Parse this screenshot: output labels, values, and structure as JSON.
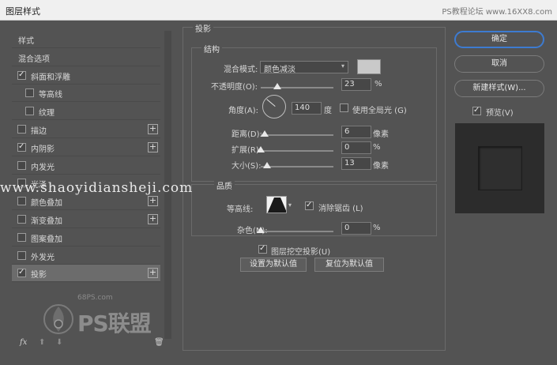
{
  "window": {
    "title": "图层样式",
    "watermark": "PS教程论坛 www.16XX8.com"
  },
  "styles_list": {
    "items": [
      {
        "label": "样式",
        "checkbox": false,
        "checked": false,
        "plus": false,
        "indent": false,
        "selected": false
      },
      {
        "label": "混合选项",
        "checkbox": false,
        "checked": false,
        "plus": false,
        "indent": false,
        "selected": false
      },
      {
        "label": "斜面和浮雕",
        "checkbox": true,
        "checked": true,
        "plus": false,
        "indent": false,
        "selected": false
      },
      {
        "label": "等高线",
        "checkbox": true,
        "checked": false,
        "plus": false,
        "indent": true,
        "selected": false
      },
      {
        "label": "纹理",
        "checkbox": true,
        "checked": false,
        "plus": false,
        "indent": true,
        "selected": false
      },
      {
        "label": "描边",
        "checkbox": true,
        "checked": false,
        "plus": true,
        "indent": false,
        "selected": false
      },
      {
        "label": "内阴影",
        "checkbox": true,
        "checked": true,
        "plus": true,
        "indent": false,
        "selected": false
      },
      {
        "label": "内发光",
        "checkbox": true,
        "checked": false,
        "plus": false,
        "indent": false,
        "selected": false
      },
      {
        "label": "光泽",
        "checkbox": true,
        "checked": false,
        "plus": false,
        "indent": false,
        "selected": false
      },
      {
        "label": "颜色叠加",
        "checkbox": true,
        "checked": false,
        "plus": true,
        "indent": false,
        "selected": false
      },
      {
        "label": "渐变叠加",
        "checkbox": true,
        "checked": false,
        "plus": true,
        "indent": false,
        "selected": false
      },
      {
        "label": "图案叠加",
        "checkbox": true,
        "checked": false,
        "plus": false,
        "indent": false,
        "selected": false
      },
      {
        "label": "外发光",
        "checkbox": true,
        "checked": false,
        "plus": false,
        "indent": false,
        "selected": false
      },
      {
        "label": "投影",
        "checkbox": true,
        "checked": true,
        "plus": true,
        "indent": false,
        "selected": true
      }
    ],
    "footer": {
      "fx": "fx",
      "up": "⬆",
      "down": "⬇",
      "trash": "🗑"
    }
  },
  "drop_shadow": {
    "section_title": "投影",
    "structure": {
      "title": "结构",
      "blend_mode_label": "混合模式:",
      "blend_mode_value": "颜色减淡",
      "shadow_color": "#c9c9c9",
      "opacity_label": "不透明度(O):",
      "opacity_value": "23",
      "opacity_unit": "%",
      "opacity_fraction": 0.23,
      "angle_label": "角度(A):",
      "angle_value": "140",
      "angle_unit": "度",
      "global_light_label": "使用全局光 (G)",
      "global_light_checked": false,
      "distance_label": "距离(D):",
      "distance_value": "6",
      "distance_unit": "像素",
      "distance_fraction": 0.05,
      "spread_label": "扩展(R):",
      "spread_value": "0",
      "spread_unit": "%",
      "spread_fraction": 0,
      "size_label": "大小(S):",
      "size_value": "13",
      "size_unit": "像素",
      "size_fraction": 0.09
    },
    "quality": {
      "title": "品质",
      "contour_label": "等高线:",
      "antialias_label": "消除锯齿 (L)",
      "antialias_checked": true,
      "noise_label": "杂色(N):",
      "noise_value": "0",
      "noise_unit": "%",
      "noise_fraction": 0
    },
    "knockout_label": "图层挖空投影(U)",
    "knockout_checked": true,
    "make_default": "设置为默认值",
    "reset_default": "复位为默认值"
  },
  "overlay_watermark": "www.shaoyidiansheji.com",
  "actions": {
    "ok": "确定",
    "cancel": "取消",
    "new_style": "新建样式(W)...",
    "preview_label": "预览(V)",
    "preview_checked": true
  },
  "logo": {
    "site": "68PS.com",
    "brand": "PS联盟"
  }
}
